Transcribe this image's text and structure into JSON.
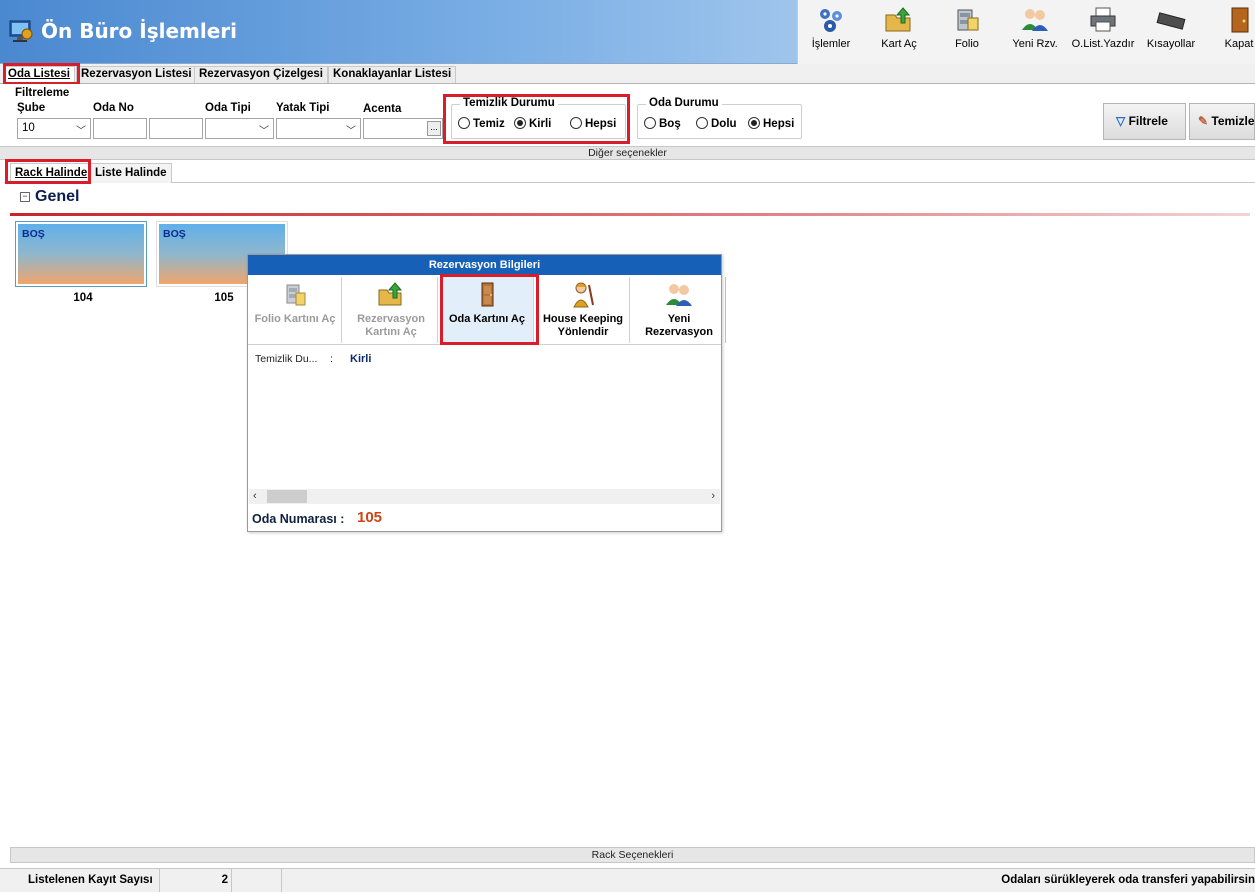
{
  "app": {
    "title": "Ön Büro İşlemleri"
  },
  "toolbar": [
    {
      "label": "İşlemler",
      "icon": "gears-network-icon"
    },
    {
      "label": "Kart Aç",
      "icon": "folder-open-icon"
    },
    {
      "label": "Folio",
      "icon": "folio-cabinet-icon"
    },
    {
      "label": "Yeni Rzv.",
      "icon": "users-add-icon"
    },
    {
      "label": "O.List.Yazdır",
      "icon": "printer-icon"
    },
    {
      "label": "Kısayollar",
      "icon": "keyboard-icon"
    },
    {
      "label": "Kapat",
      "icon": "exit-door-icon"
    }
  ],
  "main_tabs": [
    {
      "label": "Oda Listesi",
      "active": true
    },
    {
      "label": "Rezervasyon Listesi",
      "active": false
    },
    {
      "label": "Rezervasyon Çizelgesi",
      "active": false
    },
    {
      "label": "Konaklayanlar Listesi",
      "active": false
    }
  ],
  "filters": {
    "section_title": "Filtreleme",
    "sube": {
      "label": "Şube",
      "value": "10"
    },
    "oda_no": {
      "label": "Oda No",
      "value_from": "",
      "value_to": ""
    },
    "oda_tipi": {
      "label": "Oda Tipi",
      "value": ""
    },
    "yatak_tipi": {
      "label": "Yatak Tipi",
      "value": ""
    },
    "acenta": {
      "label": "Acenta",
      "value": "",
      "button": "..."
    },
    "temizlik": {
      "title": "Temizlik Durumu",
      "options": [
        {
          "label": "Temiz",
          "selected": false
        },
        {
          "label": "Kirli",
          "selected": true
        },
        {
          "label": "Hepsi",
          "selected": false
        }
      ]
    },
    "oda_durumu": {
      "title": "Oda Durumu",
      "options": [
        {
          "label": "Boş",
          "selected": false
        },
        {
          "label": "Dolu",
          "selected": false
        },
        {
          "label": "Hepsi",
          "selected": true
        }
      ]
    },
    "filter_button": "Filtrele",
    "clear_button": "Temizle"
  },
  "diger_label": "Diğer seçenekler",
  "sub_tabs": [
    {
      "label": "Rack Halinde",
      "active": true
    },
    {
      "label": "Liste Halinde",
      "active": false
    }
  ],
  "group": {
    "title": "Genel",
    "toggle": "−"
  },
  "rooms": [
    {
      "number": "104",
      "status": "BOŞ"
    },
    {
      "number": "105",
      "status": "BOŞ"
    }
  ],
  "popup": {
    "title": "Rezervasyon Bilgileri",
    "buttons": [
      {
        "label": "Folio Kartını Aç",
        "icon": "folio-cabinet-icon",
        "enabled": false
      },
      {
        "label": "Rezervasyon Kartını Aç",
        "icon": "folder-open-icon",
        "enabled": false
      },
      {
        "label": "Oda Kartını Aç",
        "icon": "door-icon",
        "enabled": true
      },
      {
        "label": "House Keeping Yönlendir",
        "icon": "housekeeper-icon",
        "enabled": true
      },
      {
        "label": "Yeni Rezervasyon",
        "icon": "users-add-icon",
        "enabled": true
      }
    ],
    "info": {
      "label": "Temizlik Du...",
      "separator": ":",
      "value": "Kirli"
    },
    "room_label": "Oda Numarası :",
    "room_value": "105"
  },
  "rack_label": "Rack Seçenekleri",
  "status_bar": {
    "count_label": "Listelenen Kayıt Sayısı",
    "count_value": "2",
    "hint": "Odaları sürükleyerek oda transferi yapabilirsin"
  },
  "colors": {
    "highlight": "#d81d2b",
    "titlebar": "#4a88d0",
    "popup_header": "#1660b8",
    "room_number": "#d04316"
  }
}
